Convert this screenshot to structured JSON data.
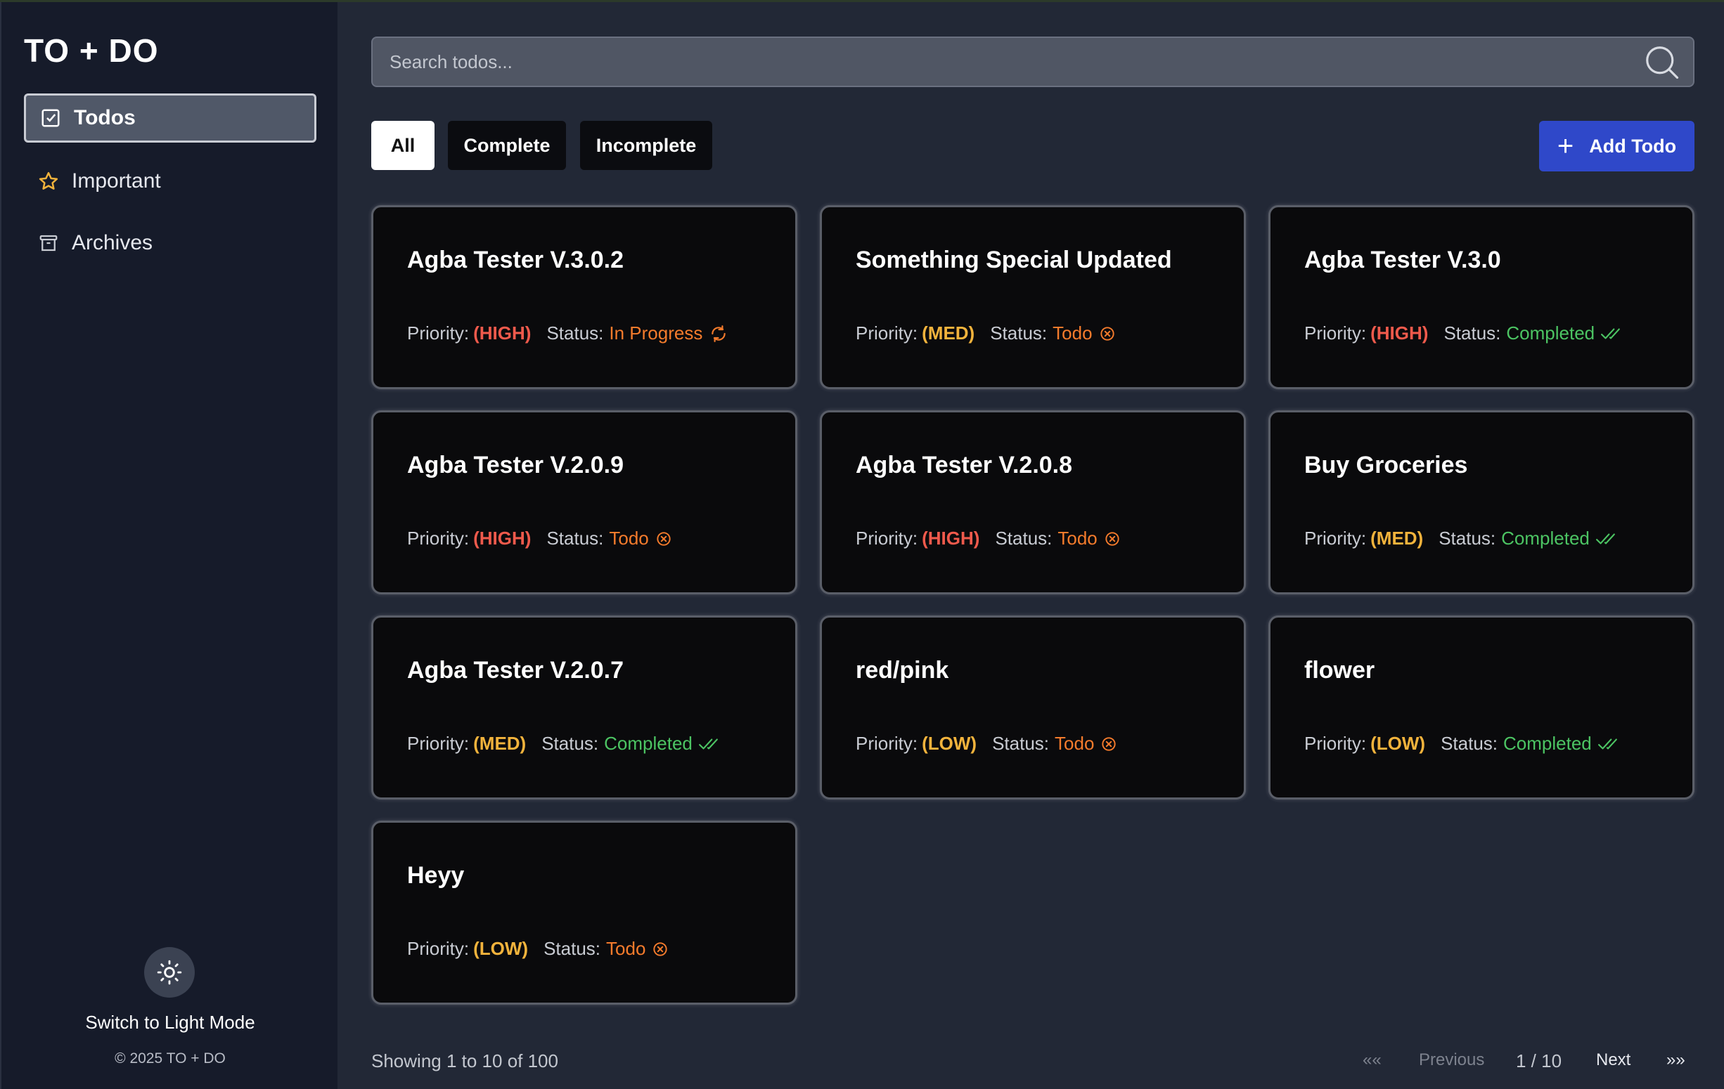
{
  "app": {
    "logo": "TO + DO"
  },
  "sidebar": {
    "items": [
      {
        "label": "Todos",
        "icon": "checkbox-icon",
        "active": true
      },
      {
        "label": "Important",
        "icon": "star-icon"
      },
      {
        "label": "Archives",
        "icon": "archive-icon"
      }
    ],
    "theme_toggle_label": "Switch to Light Mode",
    "copyright": "© 2025 TO + DO"
  },
  "search": {
    "placeholder": "Search todos..."
  },
  "filters": {
    "all": "All",
    "complete": "Complete",
    "incomplete": "Incomplete"
  },
  "add_button": {
    "label": "Add Todo"
  },
  "labels": {
    "priority": "Priority:",
    "status": "Status:"
  },
  "colors": {
    "high": "#ef5a4c",
    "med": "#f2b33c",
    "low": "#f2b33c",
    "todo": "#f47b2c",
    "in_progress": "#f47b2c",
    "completed": "#4cc463",
    "accent": "#2f48c9"
  },
  "todos": [
    {
      "title": "Agba Tester V.3.0.2",
      "priority": "(HIGH)",
      "priority_level": "high",
      "status": "In Progress",
      "status_key": "in_progress"
    },
    {
      "title": "Something Special Updated",
      "priority": "(MED)",
      "priority_level": "med",
      "status": "Todo",
      "status_key": "todo"
    },
    {
      "title": "Agba Tester V.3.0",
      "priority": "(HIGH)",
      "priority_level": "high",
      "status": "Completed",
      "status_key": "completed"
    },
    {
      "title": "Agba Tester V.2.0.9",
      "priority": "(HIGH)",
      "priority_level": "high",
      "status": "Todo",
      "status_key": "todo"
    },
    {
      "title": "Agba Tester V.2.0.8",
      "priority": "(HIGH)",
      "priority_level": "high",
      "status": "Todo",
      "status_key": "todo"
    },
    {
      "title": "Buy Groceries",
      "priority": "(MED)",
      "priority_level": "med",
      "status": "Completed",
      "status_key": "completed"
    },
    {
      "title": "Agba Tester V.2.0.7",
      "priority": "(MED)",
      "priority_level": "med",
      "status": "Completed",
      "status_key": "completed"
    },
    {
      "title": "red/pink",
      "priority": "(LOW)",
      "priority_level": "low",
      "status": "Todo",
      "status_key": "todo"
    },
    {
      "title": "flower",
      "priority": "(LOW)",
      "priority_level": "low",
      "status": "Completed",
      "status_key": "completed"
    },
    {
      "title": "Heyy",
      "priority": "(LOW)",
      "priority_level": "low",
      "status": "Todo",
      "status_key": "todo"
    }
  ],
  "footer": {
    "showing": "Showing 1 to 10 of 100",
    "first": "««",
    "previous": "Previous",
    "page": "1 / 10",
    "next": "Next",
    "last": "»»"
  }
}
